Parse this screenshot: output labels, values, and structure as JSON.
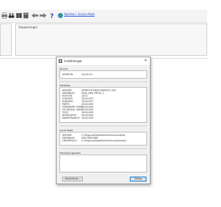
{
  "toolbar": {
    "link_text": "Nyheter i Scania Multi",
    "icons": [
      "print-icon",
      "binoculars-icon",
      "book-icon",
      "back-arrow-icon",
      "forward-arrow-icon",
      "help-icon",
      "globe-icon"
    ]
  },
  "panels": {
    "right_title": "Anpassningar"
  },
  "dialog": {
    "title": "Inställningar",
    "server": {
      "label": "Server",
      "rows": [
        {
          "key": "VERSION:",
          "value": "24.50.0.0"
        }
      ]
    },
    "databases": {
      "label": "Databas",
      "rows": [
        {
          "key": "SERVER:",
          "value": "DESKTOP-MK0V7B\\MULTI_SQL"
        },
        {
          "key": "DATABASE:",
          "value": "Multi_DB0_PROD_1"
        },
        {
          "key": "EDITION:",
          "value": "2410"
        },
        {
          "key": "CHASSIS:",
          "value": "20241007"
        },
        {
          "key": "ENGINES:",
          "value": "20241007"
        },
        {
          "key": "PARTS:",
          "value": "20241003"
        },
        {
          "key": "STANDARD TIMES:",
          "value": "20241003"
        },
        {
          "key": "TECHNICAL DATA:",
          "value": "20241003"
        },
        {
          "key": "TEXT:",
          "value": "20241003"
        },
        {
          "key": "WORKSHOP:",
          "value": "20241003"
        },
        {
          "key": "MAINTENANCE:",
          "value": "20241003"
        }
      ]
    },
    "local": {
      "label": "Local data",
      "rows": [
        {
          "key": "SERVER:",
          "value": "C:\\ProgramData\\MultiOnline\\LocalDb\\"
        },
        {
          "key": "DATABASE:",
          "value": "MULTIDB.MDB"
        },
        {
          "key": "ORDERPATH:",
          "value": "C:\\ProgramData\\MultiOnline\\Selection\\"
        }
      ]
    },
    "diagnostics_label": "Felsökningsdata",
    "buttons": {
      "advanced": "Avancerat...",
      "close": "Stäng"
    }
  }
}
